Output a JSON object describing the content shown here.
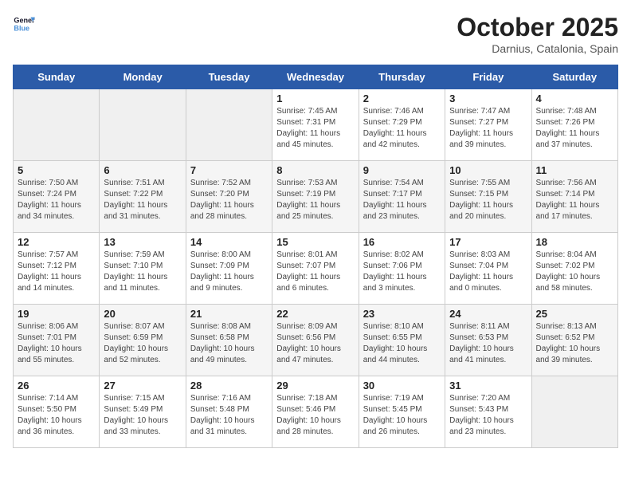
{
  "header": {
    "logo_line1": "General",
    "logo_line2": "Blue",
    "month": "October 2025",
    "location": "Darnius, Catalonia, Spain"
  },
  "weekdays": [
    "Sunday",
    "Monday",
    "Tuesday",
    "Wednesday",
    "Thursday",
    "Friday",
    "Saturday"
  ],
  "weeks": [
    [
      {
        "day": "",
        "info": ""
      },
      {
        "day": "",
        "info": ""
      },
      {
        "day": "",
        "info": ""
      },
      {
        "day": "1",
        "info": "Sunrise: 7:45 AM\nSunset: 7:31 PM\nDaylight: 11 hours\nand 45 minutes."
      },
      {
        "day": "2",
        "info": "Sunrise: 7:46 AM\nSunset: 7:29 PM\nDaylight: 11 hours\nand 42 minutes."
      },
      {
        "day": "3",
        "info": "Sunrise: 7:47 AM\nSunset: 7:27 PM\nDaylight: 11 hours\nand 39 minutes."
      },
      {
        "day": "4",
        "info": "Sunrise: 7:48 AM\nSunset: 7:26 PM\nDaylight: 11 hours\nand 37 minutes."
      }
    ],
    [
      {
        "day": "5",
        "info": "Sunrise: 7:50 AM\nSunset: 7:24 PM\nDaylight: 11 hours\nand 34 minutes."
      },
      {
        "day": "6",
        "info": "Sunrise: 7:51 AM\nSunset: 7:22 PM\nDaylight: 11 hours\nand 31 minutes."
      },
      {
        "day": "7",
        "info": "Sunrise: 7:52 AM\nSunset: 7:20 PM\nDaylight: 11 hours\nand 28 minutes."
      },
      {
        "day": "8",
        "info": "Sunrise: 7:53 AM\nSunset: 7:19 PM\nDaylight: 11 hours\nand 25 minutes."
      },
      {
        "day": "9",
        "info": "Sunrise: 7:54 AM\nSunset: 7:17 PM\nDaylight: 11 hours\nand 23 minutes."
      },
      {
        "day": "10",
        "info": "Sunrise: 7:55 AM\nSunset: 7:15 PM\nDaylight: 11 hours\nand 20 minutes."
      },
      {
        "day": "11",
        "info": "Sunrise: 7:56 AM\nSunset: 7:14 PM\nDaylight: 11 hours\nand 17 minutes."
      }
    ],
    [
      {
        "day": "12",
        "info": "Sunrise: 7:57 AM\nSunset: 7:12 PM\nDaylight: 11 hours\nand 14 minutes."
      },
      {
        "day": "13",
        "info": "Sunrise: 7:59 AM\nSunset: 7:10 PM\nDaylight: 11 hours\nand 11 minutes."
      },
      {
        "day": "14",
        "info": "Sunrise: 8:00 AM\nSunset: 7:09 PM\nDaylight: 11 hours\nand 9 minutes."
      },
      {
        "day": "15",
        "info": "Sunrise: 8:01 AM\nSunset: 7:07 PM\nDaylight: 11 hours\nand 6 minutes."
      },
      {
        "day": "16",
        "info": "Sunrise: 8:02 AM\nSunset: 7:06 PM\nDaylight: 11 hours\nand 3 minutes."
      },
      {
        "day": "17",
        "info": "Sunrise: 8:03 AM\nSunset: 7:04 PM\nDaylight: 11 hours\nand 0 minutes."
      },
      {
        "day": "18",
        "info": "Sunrise: 8:04 AM\nSunset: 7:02 PM\nDaylight: 10 hours\nand 58 minutes."
      }
    ],
    [
      {
        "day": "19",
        "info": "Sunrise: 8:06 AM\nSunset: 7:01 PM\nDaylight: 10 hours\nand 55 minutes."
      },
      {
        "day": "20",
        "info": "Sunrise: 8:07 AM\nSunset: 6:59 PM\nDaylight: 10 hours\nand 52 minutes."
      },
      {
        "day": "21",
        "info": "Sunrise: 8:08 AM\nSunset: 6:58 PM\nDaylight: 10 hours\nand 49 minutes."
      },
      {
        "day": "22",
        "info": "Sunrise: 8:09 AM\nSunset: 6:56 PM\nDaylight: 10 hours\nand 47 minutes."
      },
      {
        "day": "23",
        "info": "Sunrise: 8:10 AM\nSunset: 6:55 PM\nDaylight: 10 hours\nand 44 minutes."
      },
      {
        "day": "24",
        "info": "Sunrise: 8:11 AM\nSunset: 6:53 PM\nDaylight: 10 hours\nand 41 minutes."
      },
      {
        "day": "25",
        "info": "Sunrise: 8:13 AM\nSunset: 6:52 PM\nDaylight: 10 hours\nand 39 minutes."
      }
    ],
    [
      {
        "day": "26",
        "info": "Sunrise: 7:14 AM\nSunset: 5:50 PM\nDaylight: 10 hours\nand 36 minutes."
      },
      {
        "day": "27",
        "info": "Sunrise: 7:15 AM\nSunset: 5:49 PM\nDaylight: 10 hours\nand 33 minutes."
      },
      {
        "day": "28",
        "info": "Sunrise: 7:16 AM\nSunset: 5:48 PM\nDaylight: 10 hours\nand 31 minutes."
      },
      {
        "day": "29",
        "info": "Sunrise: 7:18 AM\nSunset: 5:46 PM\nDaylight: 10 hours\nand 28 minutes."
      },
      {
        "day": "30",
        "info": "Sunrise: 7:19 AM\nSunset: 5:45 PM\nDaylight: 10 hours\nand 26 minutes."
      },
      {
        "day": "31",
        "info": "Sunrise: 7:20 AM\nSunset: 5:43 PM\nDaylight: 10 hours\nand 23 minutes."
      },
      {
        "day": "",
        "info": ""
      }
    ]
  ]
}
